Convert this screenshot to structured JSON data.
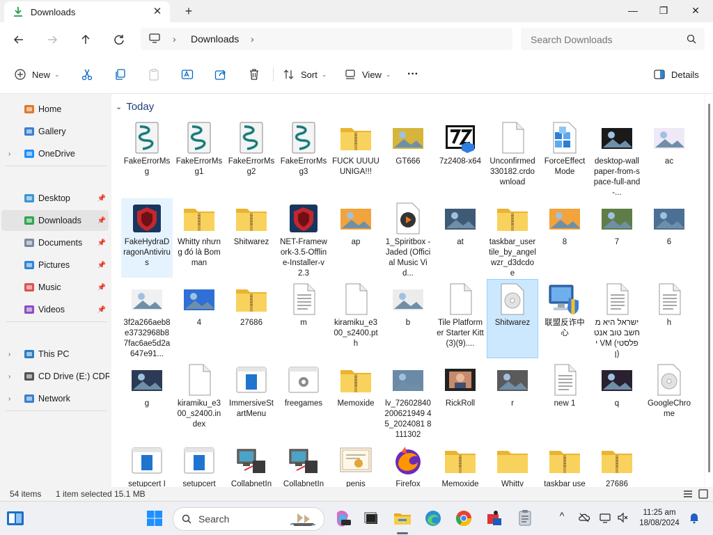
{
  "window": {
    "tab_title": "Downloads",
    "close_tab": "✕",
    "new_tab": "+",
    "minimize": "—",
    "maximize": "❐",
    "close": "✕"
  },
  "address": {
    "location": "Downloads",
    "search_placeholder": "Search Downloads"
  },
  "commands": {
    "new": "New",
    "sort": "Sort",
    "view": "View",
    "more": "···",
    "details": "Details"
  },
  "sidebar": {
    "items": [
      {
        "label": "Home",
        "pinned": false,
        "expand": false
      },
      {
        "label": "Gallery",
        "pinned": false,
        "expand": false
      },
      {
        "label": "OneDrive",
        "pinned": false,
        "expand": true
      },
      {
        "label": "Desktop",
        "pinned": true,
        "expand": false
      },
      {
        "label": "Downloads",
        "pinned": true,
        "expand": false
      },
      {
        "label": "Documents",
        "pinned": true,
        "expand": false
      },
      {
        "label": "Pictures",
        "pinned": true,
        "expand": false
      },
      {
        "label": "Music",
        "pinned": true,
        "expand": false
      },
      {
        "label": "Videos",
        "pinned": true,
        "expand": false
      },
      {
        "label": "This PC",
        "pinned": false,
        "expand": true
      },
      {
        "label": "CD Drive (E:) CDRO",
        "pinned": false,
        "expand": true
      },
      {
        "label": "Network",
        "pinned": false,
        "expand": true
      }
    ],
    "expand_glyph": "›",
    "pin_glyph": "📌"
  },
  "content": {
    "group": "Today",
    "files": [
      {
        "name": "FakeErrorMsg",
        "icon": "script-icon"
      },
      {
        "name": "FakeErrorMsg1",
        "icon": "script-icon"
      },
      {
        "name": "FakeErrorMsg2",
        "icon": "script-icon"
      },
      {
        "name": "FakeErrorMsg3",
        "icon": "script-icon"
      },
      {
        "name": "FUCK UUUUUNIGA!!!",
        "icon": "zip-folder-icon"
      },
      {
        "name": "GT666",
        "icon": "image-icon"
      },
      {
        "name": "7z2408-x64",
        "icon": "7zip-icon"
      },
      {
        "name": "Unconfirmed 330182.crdownload",
        "icon": "blank-file-icon"
      },
      {
        "name": "ForceEffectMode",
        "icon": "package-icon"
      },
      {
        "name": "desktop-wallpaper-from-space-full-and-...",
        "icon": "image-icon"
      },
      {
        "name": "ac",
        "icon": "image-icon"
      },
      {
        "name": "FakeHydraDragonAntivirus",
        "icon": "app-icon"
      },
      {
        "name": "Whitty nhưng đó là Bomman",
        "icon": "zip-folder-icon"
      },
      {
        "name": "Shitwarez",
        "icon": "zip-folder-icon"
      },
      {
        "name": "NET-Framework-3.5-Offline-Installer-v2.3",
        "icon": "app-icon"
      },
      {
        "name": "ap",
        "icon": "image-icon"
      },
      {
        "name": "1_Spiritbox - Jaded (Official Music Vid...",
        "icon": "media-icon"
      },
      {
        "name": "at",
        "icon": "image-icon"
      },
      {
        "name": "taskbar_usertile_by_angelwzr_d3dcdoe",
        "icon": "zip-folder-icon"
      },
      {
        "name": "8",
        "icon": "image-icon"
      },
      {
        "name": "7",
        "icon": "image-icon"
      },
      {
        "name": "6",
        "icon": "image-icon"
      },
      {
        "name": "3f2a266aeb8e3732968b87fac6ae5d2a647e91...",
        "icon": "image-icon"
      },
      {
        "name": "4",
        "icon": "image-icon"
      },
      {
        "name": "27686",
        "icon": "zip-folder-icon"
      },
      {
        "name": "m",
        "icon": "text-file-icon"
      },
      {
        "name": "kiramiku_e300_s2400.pth",
        "icon": "blank-file-icon"
      },
      {
        "name": "b",
        "icon": "image-icon"
      },
      {
        "name": "Tile Platformer Starter Kitt(3)(9)....",
        "icon": "blank-file-icon"
      },
      {
        "name": "Shitwarez",
        "icon": "disc-icon"
      },
      {
        "name": "联盟反诈中心",
        "icon": "shield-app-icon"
      },
      {
        "name": "ישראל היא מחשב טוב אנטי VM (פלסטין)",
        "icon": "text-file-icon"
      },
      {
        "name": "h",
        "icon": "text-file-icon"
      },
      {
        "name": "g",
        "icon": "image-icon"
      },
      {
        "name": "kiramiku_e300_s2400.index",
        "icon": "blank-file-icon"
      },
      {
        "name": "ImmersiveStartMenu",
        "icon": "window-app-icon"
      },
      {
        "name": "freegames",
        "icon": "settings-file-icon"
      },
      {
        "name": "Memoxide",
        "icon": "zip-folder-icon"
      },
      {
        "name": "lv_72602840200621949 45_2024081 8111302",
        "icon": "image-icon"
      },
      {
        "name": "RickRoll",
        "icon": "video-icon"
      },
      {
        "name": "r",
        "icon": "image-icon"
      },
      {
        "name": "new 1",
        "icon": "text-file-icon"
      },
      {
        "name": "q",
        "icon": "image-icon"
      },
      {
        "name": "GoogleChrome",
        "icon": "disc-icon"
      },
      {
        "name": "setupcert I",
        "icon": "window-app-icon"
      },
      {
        "name": "setupcert",
        "icon": "window-app-icon"
      },
      {
        "name": "CollabnetIn",
        "icon": "network-app-icon"
      },
      {
        "name": "CollabnetIn",
        "icon": "network-app-icon"
      },
      {
        "name": "penis",
        "icon": "certificate-icon"
      },
      {
        "name": "Firefox",
        "icon": "firefox-icon"
      },
      {
        "name": "Memoxide",
        "icon": "zip-folder-icon"
      },
      {
        "name": "Whittv",
        "icon": "folder-icon"
      },
      {
        "name": "taskbar use",
        "icon": "zip-folder-icon"
      },
      {
        "name": "27686",
        "icon": "zip-folder-icon"
      }
    ]
  },
  "status": {
    "items_count": "54 items",
    "selected": "1 item selected",
    "size": "15.1 MB"
  },
  "taskbar": {
    "search_label": "Search",
    "time": "11:25 am",
    "date": "18/08/2024",
    "overflow": "^"
  },
  "colors": {
    "accent": "#0067c0",
    "folder": "#f4c342",
    "selection": "#cce8ff"
  }
}
